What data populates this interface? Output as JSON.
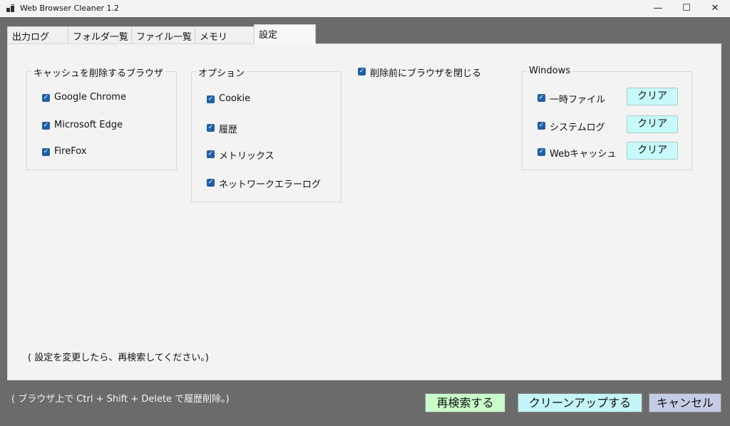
{
  "window": {
    "title": "Web Browser Cleaner 1.2"
  },
  "window_controls": {
    "minimize": "—",
    "maximize": "☐",
    "close": "✕"
  },
  "tabs": [
    {
      "label": "出力ログ"
    },
    {
      "label": "フォルダ一覧"
    },
    {
      "label": "ファイル一覧"
    },
    {
      "label": "メモリ"
    },
    {
      "label": "設定"
    }
  ],
  "cache_group": {
    "title": "キャッシュを削除するブラウザ",
    "items": [
      {
        "label": "Google Chrome",
        "checked": true
      },
      {
        "label": "Microsoft Edge",
        "checked": true
      },
      {
        "label": "FireFox",
        "checked": true
      }
    ]
  },
  "option_group": {
    "title": "オプション",
    "items": [
      {
        "label": "Cookie",
        "checked": true
      },
      {
        "label": "履歴",
        "checked": true
      },
      {
        "label": "メトリックス",
        "checked": true
      },
      {
        "label": "ネットワークエラーログ",
        "checked": true
      }
    ]
  },
  "close_before_delete": {
    "label": "削除前にブラウザを閉じる",
    "checked": true
  },
  "windows_group": {
    "title": "Windows",
    "items": [
      {
        "label": "一時ファイル",
        "checked": true,
        "button": "クリア"
      },
      {
        "label": "システムログ",
        "checked": true,
        "button": "クリア"
      },
      {
        "label": "Webキャッシュ",
        "checked": true,
        "button": "クリア"
      }
    ]
  },
  "settings_note": "( 設定を変更したら、再検索してください。)",
  "footer_note": "( ブラウザ上で Ctrl + Shift + Delete で履歴削除。)",
  "buttons": {
    "research": "再検索する",
    "cleanup": "クリーンアップする",
    "cancel": "キャンセル"
  },
  "colors": {
    "research_bg": "#c8fcc8",
    "cleanup_bg": "#c4f5f7",
    "cancel_bg": "#c5cde6",
    "checkbox": "#1f5fa8"
  },
  "icons": {
    "app": "app-icon",
    "check": "checkbox-checked-icon"
  }
}
